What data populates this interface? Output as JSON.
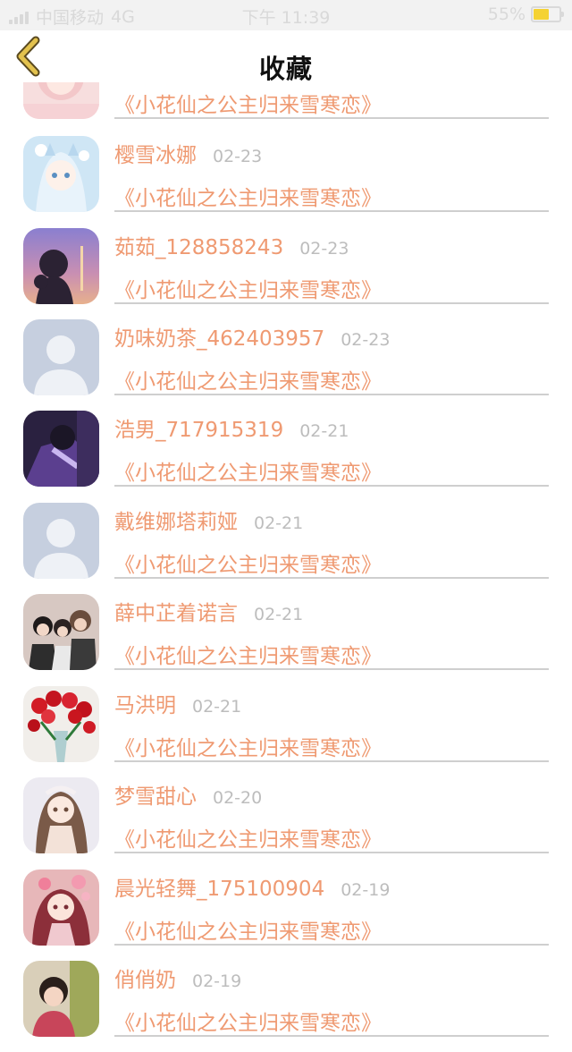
{
  "status_bar": {
    "carrier": "中国移动",
    "network": "4G",
    "time": "下午 11:39",
    "battery_percent": "55%",
    "battery_level": 0.55,
    "colors": {
      "text": "#d9d9d9",
      "battery_fill": "#f5d232"
    }
  },
  "nav": {
    "title": "收藏",
    "back_icon": "chevron-left-icon",
    "colors": {
      "back_icon": "#e3c24e"
    }
  },
  "colors": {
    "accent": "#ef9a72",
    "date": "#bdbdbd",
    "divider": "#cfcfcf"
  },
  "favorites": [
    {
      "name": "",
      "date": "",
      "book": "《小花仙之公主归来雪寒恋》",
      "avatar": "anime-pink"
    },
    {
      "name": "樱雪冰娜",
      "date": "02-23",
      "book": "《小花仙之公主归来雪寒恋》",
      "avatar": "anime-ice"
    },
    {
      "name": "茹茹_128858243",
      "date": "02-23",
      "book": "《小花仙之公主归来雪寒恋》",
      "avatar": "sunset-girl"
    },
    {
      "name": "奶味奶茶_462403957",
      "date": "02-23",
      "book": "《小花仙之公主归来雪寒恋》",
      "avatar": "default-person"
    },
    {
      "name": "浩男_717915319",
      "date": "02-21",
      "book": "《小花仙之公主归来雪寒恋》",
      "avatar": "anime-dark"
    },
    {
      "name": "戴维娜塔莉娅",
      "date": "02-21",
      "book": "《小花仙之公主归来雪寒恋》",
      "avatar": "default-person"
    },
    {
      "name": "薛中芷着诺言",
      "date": "02-21",
      "book": "《小花仙之公主归来雪寒恋》",
      "avatar": "group-photo"
    },
    {
      "name": "马洪明",
      "date": "02-21",
      "book": "《小花仙之公主归来雪寒恋》",
      "avatar": "red-flowers"
    },
    {
      "name": "梦雪甜心",
      "date": "02-20",
      "book": "《小花仙之公主归来雪寒恋》",
      "avatar": "anime-brown"
    },
    {
      "name": "晨光轻舞_175100904",
      "date": "02-19",
      "book": "《小花仙之公主归来雪寒恋》",
      "avatar": "anime-flowers"
    },
    {
      "name": "俏俏奶",
      "date": "02-19",
      "book": "《小花仙之公主归来雪寒恋》",
      "avatar": "child-photo"
    }
  ]
}
